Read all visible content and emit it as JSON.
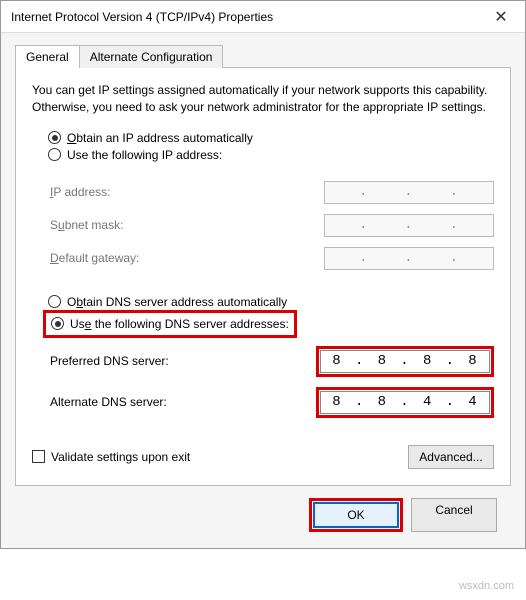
{
  "window": {
    "title": "Internet Protocol Version 4 (TCP/IPv4) Properties"
  },
  "tabs": {
    "general": "General",
    "alternate": "Alternate Configuration"
  },
  "description": "You can get IP settings assigned automatically if your network supports this capability. Otherwise, you need to ask your network administrator for the appropriate IP settings.",
  "ip": {
    "auto_label_pre": "O",
    "auto_label": "btain an IP address automatically",
    "manual_label_pre": "Use the following IP address:",
    "manual_accel": "s",
    "ip_address": "IP address:",
    "subnet": "Subnet mask:",
    "gateway": "Default gateway:"
  },
  "dns": {
    "auto_pre": "O",
    "auto_label": "btain DNS server address automatically",
    "manual_pre": "Us",
    "manual_accel": "e",
    "manual_label": " the following DNS server addresses:",
    "preferred_pre": "P",
    "preferred_label": "referred DNS server:",
    "alternate_pre": "A",
    "alternate_label": "lternate DNS server:",
    "pref_value": [
      "8",
      "8",
      "8",
      "8"
    ],
    "alt_value": [
      "8",
      "8",
      "4",
      "4"
    ]
  },
  "validate_pre": "Va",
  "validate_accel": "l",
  "validate_label": "idate settings upon exit",
  "advanced_pre": "Ad",
  "advanced_accel": "v",
  "advanced_label": "anced...",
  "ok": "OK",
  "cancel": "Cancel",
  "watermark": "wsxdn.com"
}
